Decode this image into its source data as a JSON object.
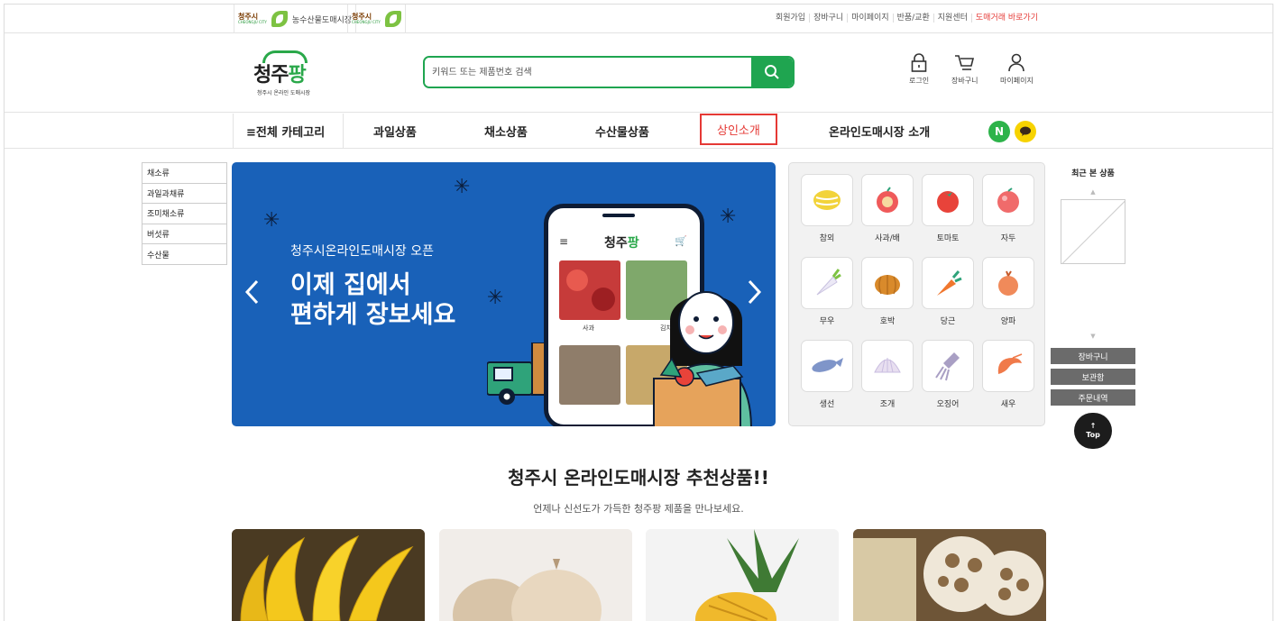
{
  "topbar": {
    "logo1_city": "청주시",
    "logo1_city_en": "CHEONGJU CITY",
    "logo1_label": "농수산물도매시장",
    "logo2_city": "청주시",
    "logo2_city_en": "CHEONGJU CITY",
    "links": [
      "회원가입",
      "장바구니",
      "마이페이지",
      "반품/교환",
      "지원센터",
      "도매거래 바로가기"
    ]
  },
  "header": {
    "logo_text": "청주",
    "logo_accent": "팡",
    "logo_sub": "청주시 온라인 도매시장",
    "search_placeholder": "키워드 또는 제품번호 검색",
    "icons": [
      {
        "icon": "lock-icon",
        "label": "로그인"
      },
      {
        "icon": "cart-icon",
        "label": "장바구니"
      },
      {
        "icon": "person-icon",
        "label": "마이페이지"
      }
    ]
  },
  "nav": {
    "all_categories": "≡전체 카테고리",
    "items": [
      "과일상품",
      "채소상품",
      "수산물상품",
      "상인소개",
      "온라인도매시장 소개"
    ],
    "highlighted": "상인소개",
    "sns": [
      "N",
      "talk-icon"
    ]
  },
  "sidebar": {
    "categories": [
      "채소류",
      "과일과채류",
      "조미채소류",
      "버섯류",
      "수산물"
    ]
  },
  "banner": {
    "subtitle": "청주시온라인도매시장 오픈",
    "headline": "이제 집에서\n편하게 장보세요",
    "phone_logo": "청주",
    "phone_logo_accent": "팡",
    "phone_item1": "사과",
    "phone_item2": "김치"
  },
  "category_grid": {
    "items": [
      {
        "label": "참외",
        "icon": "melon-icon",
        "color": "#f2d33a"
      },
      {
        "label": "사과/배",
        "icon": "apple-icon",
        "color": "#ef5a5a"
      },
      {
        "label": "토마토",
        "icon": "tomato-icon",
        "color": "#e8433a"
      },
      {
        "label": "자두",
        "icon": "plum-icon",
        "color": "#f06b6b"
      },
      {
        "label": "무우",
        "icon": "radish-icon",
        "color": "#ece9f6"
      },
      {
        "label": "호박",
        "icon": "pumpkin-icon",
        "color": "#d98a2b"
      },
      {
        "label": "당근",
        "icon": "carrot-icon",
        "color": "#f0772e"
      },
      {
        "label": "양파",
        "icon": "onion-icon",
        "color": "#f08a5a"
      },
      {
        "label": "생선",
        "icon": "fish-icon",
        "color": "#7f95c9"
      },
      {
        "label": "조개",
        "icon": "clam-icon",
        "color": "#e8dff0"
      },
      {
        "label": "오징어",
        "icon": "squid-icon",
        "color": "#a99fc4"
      },
      {
        "label": "새우",
        "icon": "shrimp-icon",
        "color": "#f07a4a"
      }
    ]
  },
  "recent": {
    "title": "최근 본 상품",
    "up": "▲",
    "down": "▼"
  },
  "quick_buttons": [
    "장바구니",
    "보관함",
    "주문내역"
  ],
  "top_button": {
    "arrow": "↑",
    "label": "Top"
  },
  "recommend": {
    "title": "청주시 온라인도매시장 추천상품!!",
    "subtitle": "언제나 신선도가 가득한 청주팡 제품을 만나보세요.",
    "products": [
      "banana",
      "onion",
      "pineapple",
      "lotus-root"
    ]
  },
  "colors": {
    "brand_green": "#1fa550",
    "banner_blue": "#1961b8",
    "highlight_red": "#e53935"
  }
}
